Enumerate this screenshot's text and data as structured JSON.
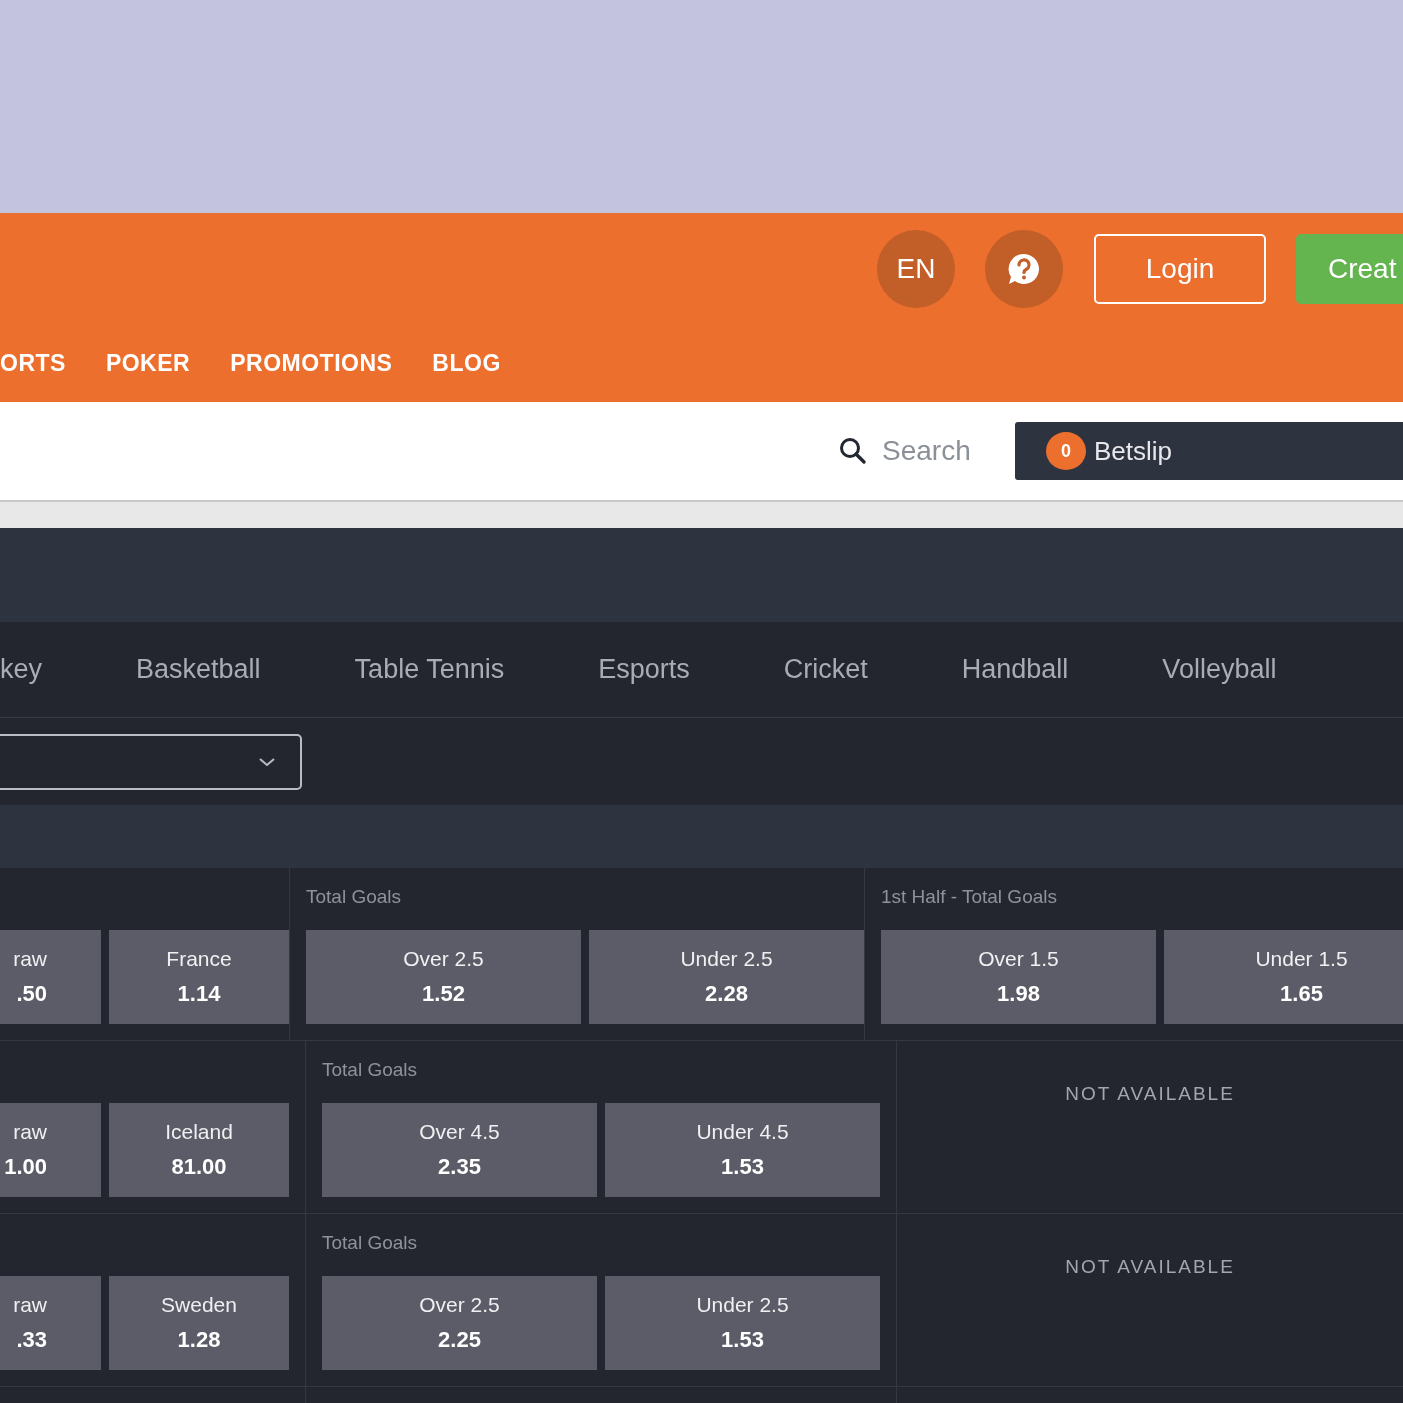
{
  "header": {
    "language": "EN",
    "login": "Login",
    "create": "Creat"
  },
  "nav": [
    "ORTS",
    "POKER",
    "PROMOTIONS",
    "BLOG"
  ],
  "search": {
    "placeholder": "Search"
  },
  "betslip": {
    "count": "0",
    "label": "Betslip"
  },
  "sports_tabs": [
    "key",
    "Basketball",
    "Table Tennis",
    "Esports",
    "Cricket",
    "Handball",
    "Volleyball"
  ],
  "events": [
    {
      "match_result": [
        {
          "label": "raw",
          "odds": ".50"
        },
        {
          "label": "France",
          "odds": "1.14"
        }
      ],
      "total_goals": {
        "title": "Total Goals",
        "outcomes": [
          {
            "label": "Over 2.5",
            "odds": "1.52"
          },
          {
            "label": "Under 2.5",
            "odds": "2.28"
          }
        ]
      },
      "half_total_goals": {
        "available": true,
        "title": "1st Half - Total Goals",
        "outcomes": [
          {
            "label": "Over 1.5",
            "odds": "1.98"
          },
          {
            "label": "Under 1.5",
            "odds": "1.65"
          }
        ]
      }
    },
    {
      "match_result": [
        {
          "label": "raw",
          "odds": "1.00"
        },
        {
          "label": "Iceland",
          "odds": "81.00"
        }
      ],
      "total_goals": {
        "title": "Total Goals",
        "outcomes": [
          {
            "label": "Over 4.5",
            "odds": "2.35"
          },
          {
            "label": "Under 4.5",
            "odds": "1.53"
          }
        ]
      },
      "half_total_goals": {
        "available": false,
        "message": "NOT AVAILABLE"
      }
    },
    {
      "match_result": [
        {
          "label": "raw",
          "odds": ".33"
        },
        {
          "label": "Sweden",
          "odds": "1.28"
        }
      ],
      "total_goals": {
        "title": "Total Goals",
        "outcomes": [
          {
            "label": "Over 2.5",
            "odds": "2.25"
          },
          {
            "label": "Under 2.5",
            "odds": "1.53"
          }
        ]
      },
      "half_total_goals": {
        "available": false,
        "message": "NOT AVAILABLE"
      }
    }
  ]
}
